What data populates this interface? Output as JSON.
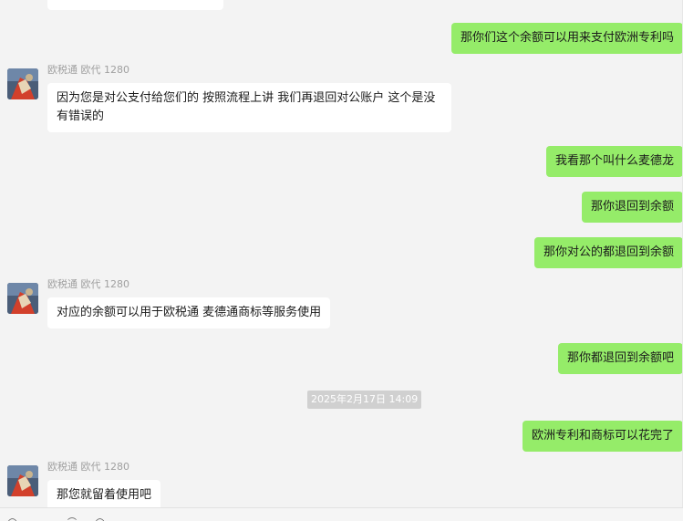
{
  "messages": {
    "out_1": "那你们这个余额可以用来支付欧洲专利吗",
    "in_1": "因为您是对公支付给您们的  按照流程上讲 我们再退回对公账户 这个是没有错误的",
    "out_2": "我看那个叫什么麦德龙",
    "out_3": "那你退回到余额",
    "out_4": "那你对公的都退回到余额",
    "in_2": "对应的余额可以用于欧税通 麦德通商标等服务使用",
    "out_5": "那你都退回到余额吧",
    "out_6": "欧洲专利和商标可以花完了",
    "in_3": "那您就留着使用吧"
  },
  "sender": {
    "name": "欧税通 欧代 1280"
  },
  "timestamp": "2025年2月17日 14:09",
  "colors": {
    "outgoing_bubble": "#95ec69",
    "incoming_bubble": "#ffffff",
    "background": "#f3f3f3"
  },
  "icons": [
    "avatar-image",
    "emoji-icon",
    "folder-icon"
  ]
}
